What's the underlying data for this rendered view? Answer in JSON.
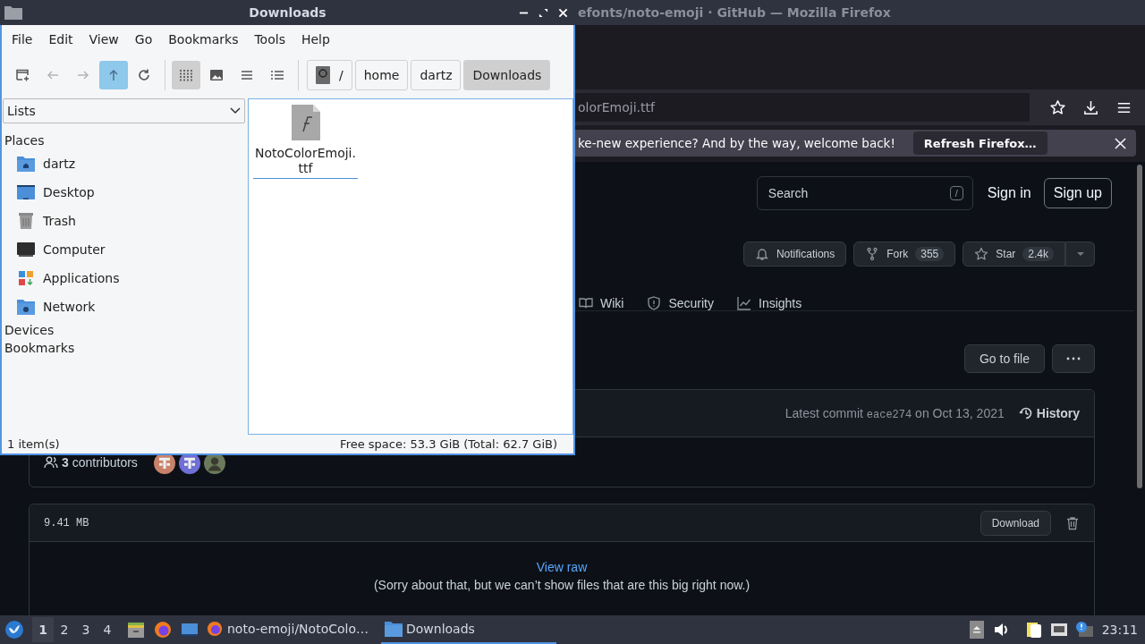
{
  "firefox": {
    "title": "efonts/noto-emoji · GitHub — Mozilla Firefox",
    "url": "olorEmoji.ttf",
    "notification": {
      "message": "ke-new experience? And by the way, welcome back!",
      "button": "Refresh Firefox…"
    }
  },
  "github": {
    "search": {
      "placeholder": "Search",
      "shortcut": "/"
    },
    "sign_in": "Sign in",
    "sign_up": "Sign up",
    "repo_actions": [
      {
        "kind": "notifications",
        "label": "Notifications"
      },
      {
        "kind": "fork",
        "label": "Fork",
        "count": "355"
      },
      {
        "kind": "star",
        "label": "Star",
        "count": "2.4k"
      }
    ],
    "tabs": [
      {
        "kind": "wiki",
        "label": "Wiki"
      },
      {
        "kind": "security",
        "label": "Security"
      },
      {
        "kind": "insights",
        "label": "Insights"
      }
    ],
    "go_to_file": "Go to file",
    "commit": {
      "label": "Latest commit",
      "sha": "eace274",
      "date": "on Oct 13, 2021",
      "history": "History"
    },
    "contributors": {
      "count": "3",
      "label": "contributors",
      "avatars": [
        {
          "kind": "pattern",
          "color": "#c8826a"
        },
        {
          "kind": "pattern",
          "color": "#6f6fd6"
        },
        {
          "kind": "photo",
          "color": "#6b7a5a"
        }
      ]
    },
    "file": {
      "size": "9.41 MB",
      "download": "Download",
      "view_raw": "View raw",
      "message": "(Sorry about that, but we can’t show files that are this big right now.)"
    }
  },
  "file_manager": {
    "title": "Downloads",
    "menu": [
      "File",
      "Edit",
      "View",
      "Go",
      "Bookmarks",
      "Tools",
      "Help"
    ],
    "nav_buttons": [
      {
        "kind": "new-window",
        "disabled": false,
        "hovered": false
      },
      {
        "kind": "back",
        "disabled": true,
        "hovered": false
      },
      {
        "kind": "forward",
        "disabled": true,
        "hovered": false
      },
      {
        "kind": "up",
        "disabled": false,
        "hovered": true
      },
      {
        "kind": "reload",
        "disabled": false,
        "hovered": false
      }
    ],
    "view_buttons": [
      {
        "kind": "icons",
        "selected": true
      },
      {
        "kind": "thumbnails",
        "selected": false
      },
      {
        "kind": "compact",
        "selected": false
      },
      {
        "kind": "details",
        "selected": false
      }
    ],
    "path": [
      {
        "kind": "root",
        "label": "/",
        "selected": false
      },
      {
        "kind": "folder",
        "label": "home",
        "selected": false
      },
      {
        "kind": "folder",
        "label": "dartz",
        "selected": false
      },
      {
        "kind": "folder",
        "label": "Downloads",
        "selected": true
      }
    ],
    "side_pane": {
      "mode": "Lists",
      "sections": [
        {
          "title": "Places",
          "items": [
            {
              "kind": "home",
              "label": "dartz"
            },
            {
              "kind": "desktop",
              "label": "Desktop"
            },
            {
              "kind": "trash",
              "label": "Trash"
            },
            {
              "kind": "computer",
              "label": "Computer"
            },
            {
              "kind": "applications",
              "label": "Applications"
            },
            {
              "kind": "network",
              "label": "Network"
            }
          ]
        },
        {
          "title": "Devices"
        },
        {
          "title": "Bookmarks"
        }
      ]
    },
    "files": [
      {
        "kind": "font",
        "name": "NotoColorEmoji.ttf",
        "focused": true
      }
    ],
    "status": {
      "items": "1 item(s)",
      "free_space": "Free space: 53.3 GiB (Total: 62.7 GiB)"
    }
  },
  "taskbar": {
    "workspaces": [
      {
        "label": "1",
        "selected": true
      },
      {
        "label": "2",
        "selected": false
      },
      {
        "label": "3",
        "selected": false
      },
      {
        "label": "4",
        "selected": false
      }
    ],
    "tasks": [
      {
        "kind": "firefox",
        "label": "noto-emoji/NotoColo…",
        "selected": false
      },
      {
        "kind": "folder",
        "label": "Downloads",
        "selected": true
      }
    ],
    "clock": "23:11"
  }
}
